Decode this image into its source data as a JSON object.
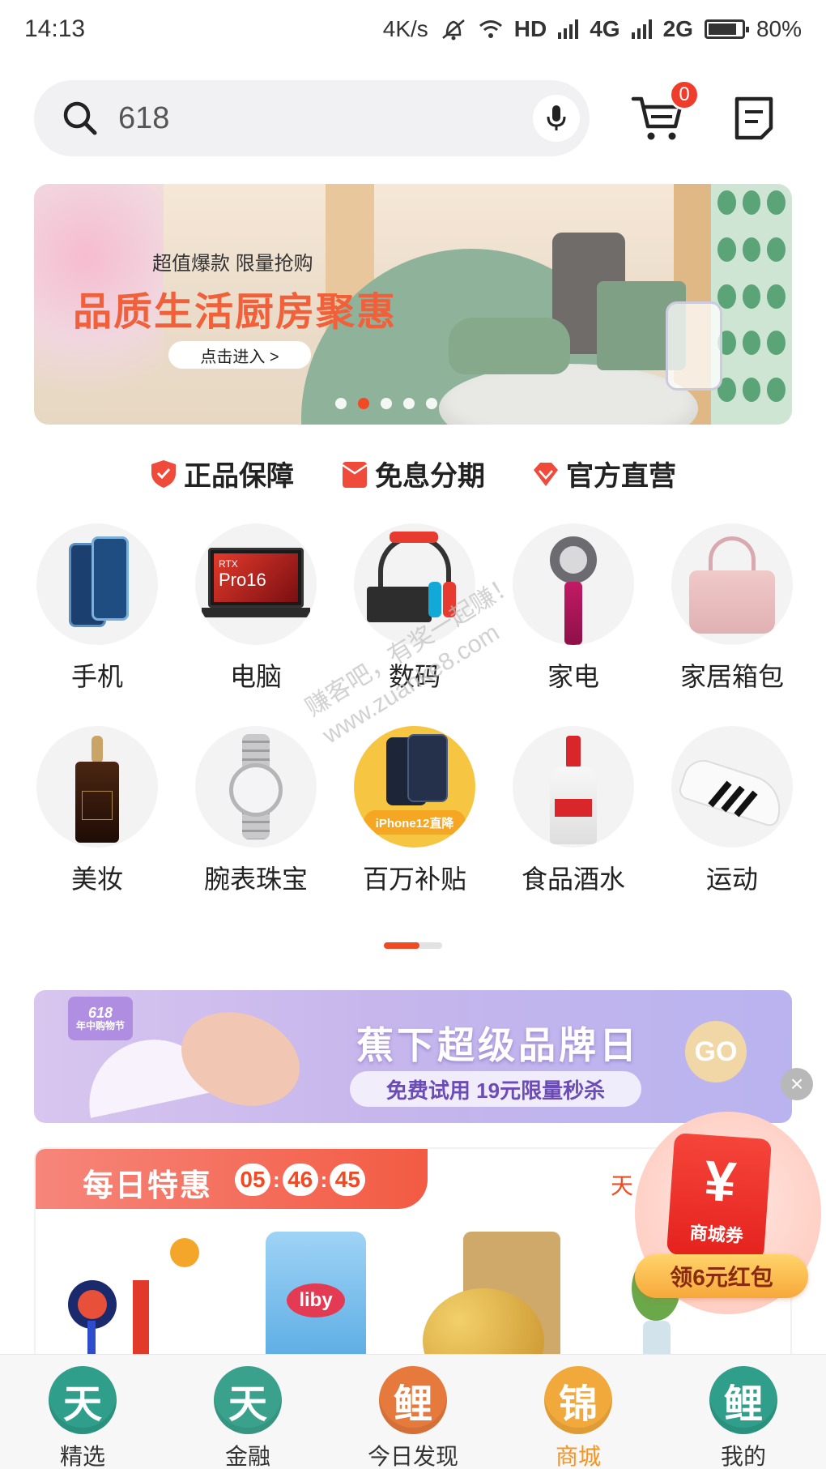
{
  "status_bar": {
    "time": "14:13",
    "speed": "4K/s",
    "hd": "HD",
    "net1": "4G",
    "net2": "2G",
    "battery": "80%"
  },
  "search": {
    "value": "618",
    "icon": "search-icon",
    "mic_icon": "mic-icon"
  },
  "header": {
    "cart_count": "0",
    "cart_icon": "cart-icon",
    "notes_icon": "notes-icon"
  },
  "banner": {
    "subtitle": "超值爆款 限量抢购",
    "title": "品质生活厨房聚惠",
    "button": "点击进入 >",
    "dot_count": 5,
    "active_dot": 1
  },
  "guarantees": [
    {
      "label": "正品保障",
      "icon": "shield-icon"
    },
    {
      "label": "免息分期",
      "icon": "envelope-icon"
    },
    {
      "label": "官方直营",
      "icon": "diamond-icon"
    }
  ],
  "categories": [
    {
      "label": "手机",
      "icon": "phone-icon"
    },
    {
      "label": "电脑",
      "icon": "laptop-icon"
    },
    {
      "label": "数码",
      "icon": "game-console-icon"
    },
    {
      "label": "家电",
      "icon": "hair-dryer-icon"
    },
    {
      "label": "家居箱包",
      "icon": "handbag-icon"
    },
    {
      "label": "美妆",
      "icon": "serum-bottle-icon"
    },
    {
      "label": "腕表珠宝",
      "icon": "watch-icon"
    },
    {
      "label": "百万补贴",
      "icon": "iphone12-icon"
    },
    {
      "label": "食品酒水",
      "icon": "liquor-bottle-icon"
    },
    {
      "label": "运动",
      "icon": "sneaker-icon"
    }
  ],
  "category_images": {
    "laptop_text1": "RTX",
    "laptop_text2": "Pro16",
    "iphone_text": "iPhone12直降"
  },
  "promo": {
    "tag_line1": "618",
    "tag_line2": "年中购物节",
    "title": "蕉下超级品牌日",
    "subtitle": "免费试用 19元限量秒杀",
    "go": "GO",
    "close": "×"
  },
  "daily": {
    "title": "每日特惠",
    "timer": [
      "05",
      "46",
      "45"
    ],
    "more": "天",
    "liby_text": "liby"
  },
  "coupon": {
    "symbol": "¥",
    "name": "商城券",
    "button": "领6元红包"
  },
  "watermark": {
    "line1": "赚客吧，有奖一起赚！",
    "line2": "www.zuanke8.com"
  },
  "bottom_nav": [
    {
      "label": "精选",
      "glyph": "天",
      "color": "#2f9e8a",
      "active": false
    },
    {
      "label": "金融",
      "glyph": "天",
      "color": "#3aa28c",
      "active": false
    },
    {
      "label": "今日发现",
      "glyph": "鲤",
      "color": "#e67a3c",
      "active": false
    },
    {
      "label": "商城",
      "glyph": "锦",
      "color": "#f2a93b",
      "active": true
    },
    {
      "label": "我的",
      "glyph": "鲤",
      "color": "#2f9e8a",
      "active": false
    }
  ],
  "colors": {
    "accent": "#f04a25",
    "active_tab": "#f7931e"
  }
}
